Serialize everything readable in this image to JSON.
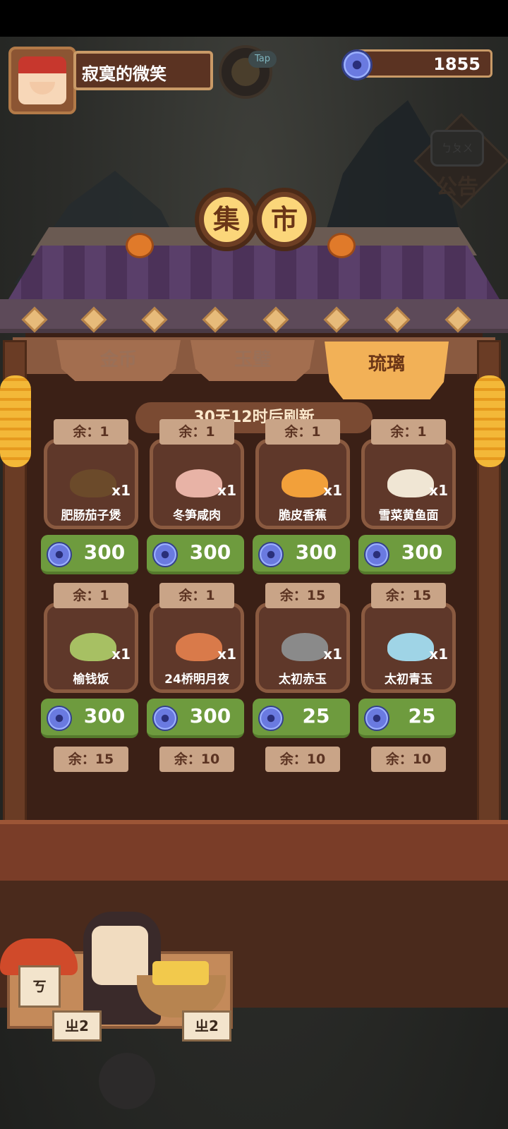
{
  "player": {
    "name": "寂寞的微笑"
  },
  "tap_label": "Tap",
  "currency": {
    "amount": "1855"
  },
  "announcement": {
    "bubble": "ㄅㄆㄨ",
    "label": "公告"
  },
  "title": [
    "集",
    "市"
  ],
  "tabs": [
    {
      "label": "金币",
      "active": false
    },
    {
      "label": "玉璧",
      "active": false
    },
    {
      "label": "琉璃",
      "active": true
    }
  ],
  "refresh_text": "30天12时后刷新",
  "items": [
    {
      "stock": "余：1",
      "name": "肥肠茄子煲",
      "qty": "x1",
      "price": "300",
      "color": "#6b4a2a"
    },
    {
      "stock": "余：1",
      "name": "冬笋咸肉",
      "qty": "x1",
      "price": "300",
      "color": "#e8b3a6"
    },
    {
      "stock": "余：1",
      "name": "脆皮香蕉",
      "qty": "x1",
      "price": "300",
      "color": "#f2a03a"
    },
    {
      "stock": "余：1",
      "name": "雪菜黄鱼面",
      "qty": "x1",
      "price": "300",
      "color": "#f0e6d4"
    },
    {
      "stock": "余：1",
      "name": "榆钱饭",
      "qty": "x1",
      "price": "300",
      "color": "#a7c063"
    },
    {
      "stock": "余：1",
      "name": "24桥明月夜",
      "qty": "x1",
      "price": "300",
      "color": "#d97a4a"
    },
    {
      "stock": "余：15",
      "name": "太初赤玉",
      "qty": "x1",
      "price": "25",
      "color": "#8a8a8a"
    },
    {
      "stock": "余：15",
      "name": "太初青玉",
      "qty": "x1",
      "price": "25",
      "color": "#9fd4e6"
    }
  ],
  "next_row_stock": [
    "余：15",
    "余：10",
    "余：10",
    "余：10"
  ],
  "vendor_signs": [
    "ㄓ2",
    "ㄓ2"
  ],
  "shelf_tag": "ㄎ"
}
